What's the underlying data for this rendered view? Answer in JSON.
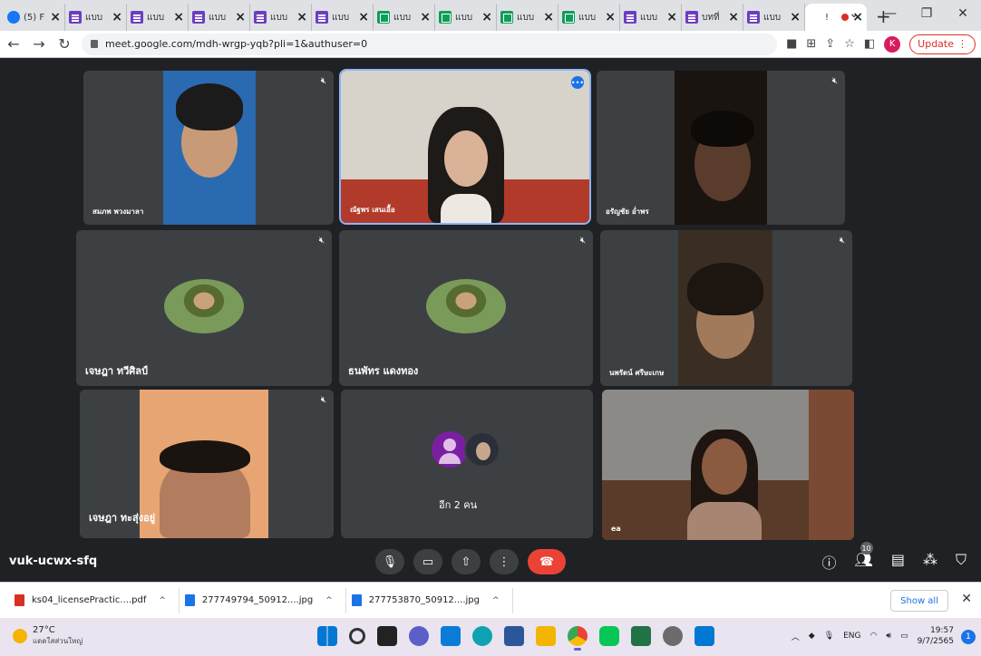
{
  "browser": {
    "tabs": [
      {
        "title": "(5) F",
        "icon": "facebook-icon"
      },
      {
        "title": "แบบ",
        "icon": "google-forms-icon"
      },
      {
        "title": "แบบ",
        "icon": "google-forms-icon"
      },
      {
        "title": "แบบ",
        "icon": "google-forms-icon"
      },
      {
        "title": "แบบ",
        "icon": "google-forms-icon"
      },
      {
        "title": "แบบ",
        "icon": "google-forms-icon"
      },
      {
        "title": "แบบ",
        "icon": "google-sheets-icon"
      },
      {
        "title": "แบบ",
        "icon": "google-sheets-icon"
      },
      {
        "title": "แบบ",
        "icon": "google-sheets-icon"
      },
      {
        "title": "แบบ",
        "icon": "google-sheets-icon"
      },
      {
        "title": "แบบ",
        "icon": "google-forms-icon"
      },
      {
        "title": "บทที่",
        "icon": "google-forms-icon"
      },
      {
        "title": "แบบ",
        "icon": "google-forms-icon"
      },
      {
        "title": "!",
        "icon": "google-meet-icon"
      }
    ],
    "new_tab": "+",
    "url": "meet.google.com/mdh-wrgp-yqb?pli=1&authuser=0",
    "profile_initial": "K",
    "update_label": "Update"
  },
  "meet": {
    "tiles": [
      {
        "name": "สมภพ พวงมาลา",
        "muted": true
      },
      {
        "name": "ณัฐพร เสนเอื้อ",
        "speaking": true
      },
      {
        "name": "อรัญชัย อ่ำพร",
        "muted": true
      },
      {
        "name": "เจษฎา ทวีศิลป์",
        "muted": true
      },
      {
        "name": "ธนพัทร แดงทอง",
        "muted": true
      },
      {
        "name": "นพรัตน์ ศรีษะเกษ",
        "muted": true
      },
      {
        "name": "เจษฎา ทะสุ่งอยู่",
        "muted": true
      },
      {
        "name": ""
      },
      {
        "name": "ea"
      }
    ],
    "others_label": "อีก 2 คน",
    "meeting_code": "vuk-ucwx-sfq",
    "participant_count": "10"
  },
  "downloads": {
    "items": [
      {
        "name": "ks04_licensePractic....pdf",
        "type": "pdf",
        "color": "#d93025"
      },
      {
        "name": "277749794_50912....jpg",
        "type": "image",
        "color": "#1a73e8"
      },
      {
        "name": "277753870_50912....jpg",
        "type": "image",
        "color": "#1a73e8"
      }
    ],
    "show_all": "Show all"
  },
  "taskbar": {
    "temperature": "27°C",
    "weather_text": "แดดใสส่วนใหญ่",
    "language": "ENG",
    "time": "19:57",
    "date": "9/7/2565",
    "notification_count": "1"
  }
}
